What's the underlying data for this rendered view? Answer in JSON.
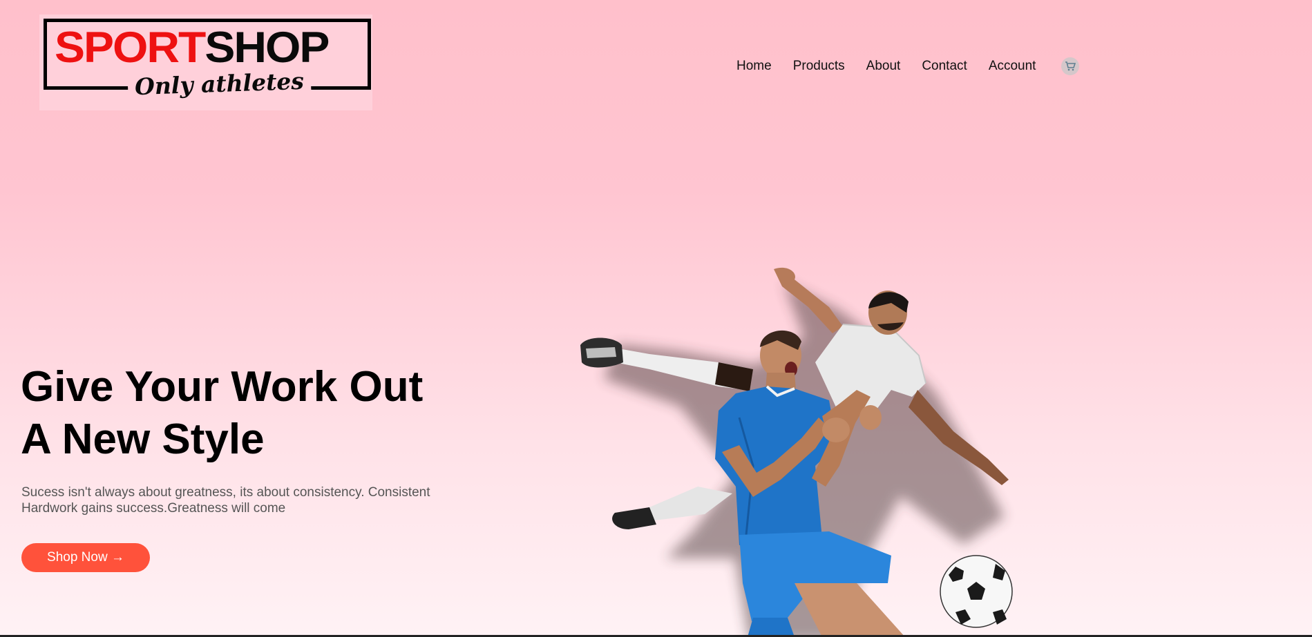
{
  "logo": {
    "word_red": "SPORT",
    "word_black": "SHOP",
    "tagline": "Only athletes"
  },
  "nav": {
    "items": [
      {
        "label": "Home"
      },
      {
        "label": "Products"
      },
      {
        "label": "About"
      },
      {
        "label": "Contact"
      },
      {
        "label": "Account"
      }
    ],
    "cart_icon": "cart-icon"
  },
  "hero": {
    "title_line1": "Give Your Work Out",
    "title_line2": "A New Style",
    "subtitle": "Sucess isn't always about greatness, its about consistency. Consistent Hardwork gains success.Greatness will come",
    "cta_label": "Shop Now →",
    "image": "soccer-players-celebrating-image"
  },
  "colors": {
    "accent": "#ff523b",
    "logo_red": "#ee1111",
    "background_top": "#ffc0cb"
  }
}
